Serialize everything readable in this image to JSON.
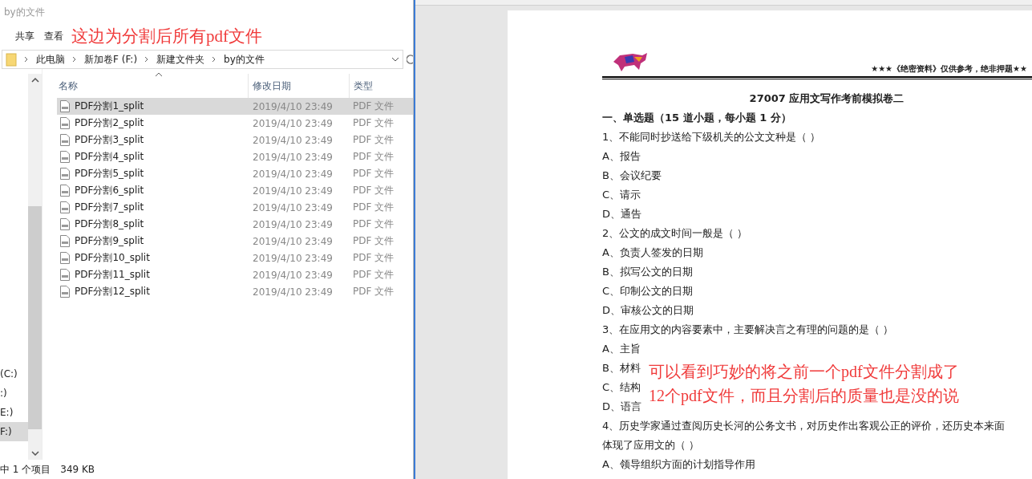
{
  "explorer": {
    "window_title": "by的文件",
    "ribbon_tabs": [
      {
        "label": "共享",
        "selected": false
      },
      {
        "label": "查看",
        "selected": false
      }
    ],
    "annotation": "这边为分割后所有pdf文件",
    "breadcrumb": [
      "此电脑",
      "新加卷F (F:)",
      "新建文件夹",
      "by的文件"
    ],
    "nav_items": [
      {
        "label": "(C:)",
        "selected": false
      },
      {
        "label": ":)",
        "selected": false
      },
      {
        "label": "E:)",
        "selected": false
      },
      {
        "label": "F:)",
        "selected": true
      }
    ],
    "columns": [
      "名称",
      "修改日期",
      "类型"
    ],
    "files": [
      {
        "name": "PDF分割1_split",
        "date": "2019/4/10 23:49",
        "type": "PDF 文件",
        "selected": true
      },
      {
        "name": "PDF分割2_split",
        "date": "2019/4/10 23:49",
        "type": "PDF 文件",
        "selected": false
      },
      {
        "name": "PDF分割3_split",
        "date": "2019/4/10 23:49",
        "type": "PDF 文件",
        "selected": false
      },
      {
        "name": "PDF分割4_split",
        "date": "2019/4/10 23:49",
        "type": "PDF 文件",
        "selected": false
      },
      {
        "name": "PDF分割5_split",
        "date": "2019/4/10 23:49",
        "type": "PDF 文件",
        "selected": false
      },
      {
        "name": "PDF分割6_split",
        "date": "2019/4/10 23:49",
        "type": "PDF 文件",
        "selected": false
      },
      {
        "name": "PDF分割7_split",
        "date": "2019/4/10 23:49",
        "type": "PDF 文件",
        "selected": false
      },
      {
        "name": "PDF分割8_split",
        "date": "2019/4/10 23:49",
        "type": "PDF 文件",
        "selected": false
      },
      {
        "name": "PDF分割9_split",
        "date": "2019/4/10 23:49",
        "type": "PDF 文件",
        "selected": false
      },
      {
        "name": "PDF分割10_split",
        "date": "2019/4/10 23:49",
        "type": "PDF 文件",
        "selected": false
      },
      {
        "name": "PDF分割11_split",
        "date": "2019/4/10 23:49",
        "type": "PDF 文件",
        "selected": false
      },
      {
        "name": "PDF分割12_split",
        "date": "2019/4/10 23:49",
        "type": "PDF 文件",
        "selected": false
      }
    ],
    "status": [
      "中 1 个项目",
      "349 KB"
    ]
  },
  "document": {
    "header_text": "★★★《绝密资料》仅供参考，绝非押题★★",
    "lines": [
      {
        "kind": "title",
        "text": "27007 应用文写作考前模拟卷二"
      },
      {
        "kind": "section",
        "text": "一、单选题（15 道小题，每小题 1 分）"
      },
      {
        "kind": "text",
        "text": "1、不能同时抄送给下级机关的公文文种是（    ）"
      },
      {
        "kind": "text",
        "text": "A、报告"
      },
      {
        "kind": "text",
        "text": "B、会议纪要"
      },
      {
        "kind": "text",
        "text": "C、请示"
      },
      {
        "kind": "text",
        "text": "D、通告"
      },
      {
        "kind": "text",
        "text": "2、公文的成文时间一般是（    ）"
      },
      {
        "kind": "text",
        "text": "A、负责人签发的日期"
      },
      {
        "kind": "text",
        "text": "B、拟写公文的日期"
      },
      {
        "kind": "text",
        "text": "C、印制公文的日期"
      },
      {
        "kind": "text",
        "text": "D、审核公文的日期"
      },
      {
        "kind": "text",
        "text": "3、在应用文的内容要素中，主要解决言之有理的问题的是（    ）"
      },
      {
        "kind": "text",
        "text": "A、主旨"
      },
      {
        "kind": "text",
        "text": "B、材料"
      },
      {
        "kind": "text",
        "text": "C、结构"
      },
      {
        "kind": "text",
        "text": "D、语言"
      },
      {
        "kind": "text",
        "text": "4、历史学家通过查阅历史长河的公务文书，对历史作出客观公正的评价，还历史本来面"
      },
      {
        "kind": "text",
        "text": "体现了应用文的（    ）"
      },
      {
        "kind": "text",
        "text": "A、领导组织方面的计划指导作用"
      }
    ],
    "annotation": [
      "可以看到巧妙的将之前一个pdf文件分割成了",
      "12个pdf文件，而且分割后的质量也是没的说"
    ]
  }
}
